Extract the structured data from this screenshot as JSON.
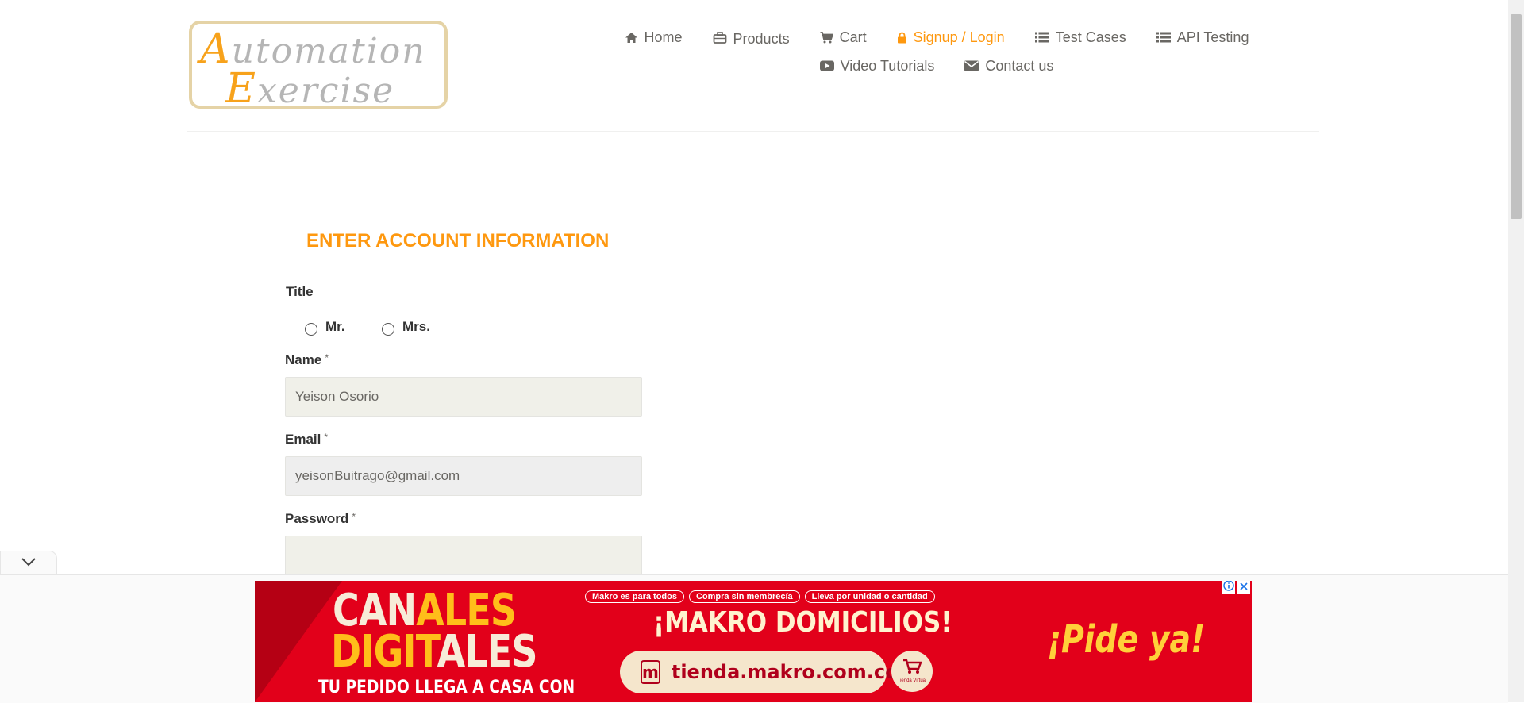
{
  "header": {
    "logo": {
      "line1_cap": "A",
      "line1_rest": "utomation",
      "line2_cap": "E",
      "line2_rest": "xercise"
    },
    "nav": [
      {
        "label": "Home",
        "icon": "home-icon"
      },
      {
        "label": "Products",
        "icon": "briefcase-icon"
      },
      {
        "label": "Cart",
        "icon": "cart-icon"
      },
      {
        "label": "Signup / Login",
        "icon": "lock-icon",
        "active": true
      },
      {
        "label": "Test Cases",
        "icon": "list-icon"
      },
      {
        "label": "API Testing",
        "icon": "list-icon"
      },
      {
        "label": "Video Tutorials",
        "icon": "youtube-icon"
      },
      {
        "label": "Contact us",
        "icon": "envelope-icon"
      }
    ],
    "colors": {
      "accent": "#fe980f",
      "text": "#696763"
    }
  },
  "form": {
    "title": "ENTER ACCOUNT INFORMATION",
    "title_label": "Title",
    "title_options": [
      "Mr.",
      "Mrs."
    ],
    "name_label": "Name",
    "name_value": "Yeison Osorio",
    "email_label": "Email",
    "email_value": "yeisonBuitrago@gmail.com",
    "password_label": "Password",
    "password_value": "",
    "required_mark": "*"
  },
  "ad": {
    "headline_line1_a": "CAN",
    "headline_line1_b": "ALES",
    "headline_line2_a": "DIGIT",
    "headline_line2_b": "ALES",
    "subline": "TU PEDIDO LLEGA A CASA CON",
    "pills": [
      "Makro es para todos",
      "Compra sin membrecía",
      "Lleva por unidad o cantidad"
    ],
    "center_headline": "¡MAKRO DOMICILIOS!",
    "url": "tienda.makro.com.co",
    "logo_letter": "m",
    "cart_caption": "Tienda Virtual",
    "cta": "¡Pide ya!",
    "colors": {
      "background": "#e2001a",
      "accent": "#ffbe1a"
    }
  }
}
